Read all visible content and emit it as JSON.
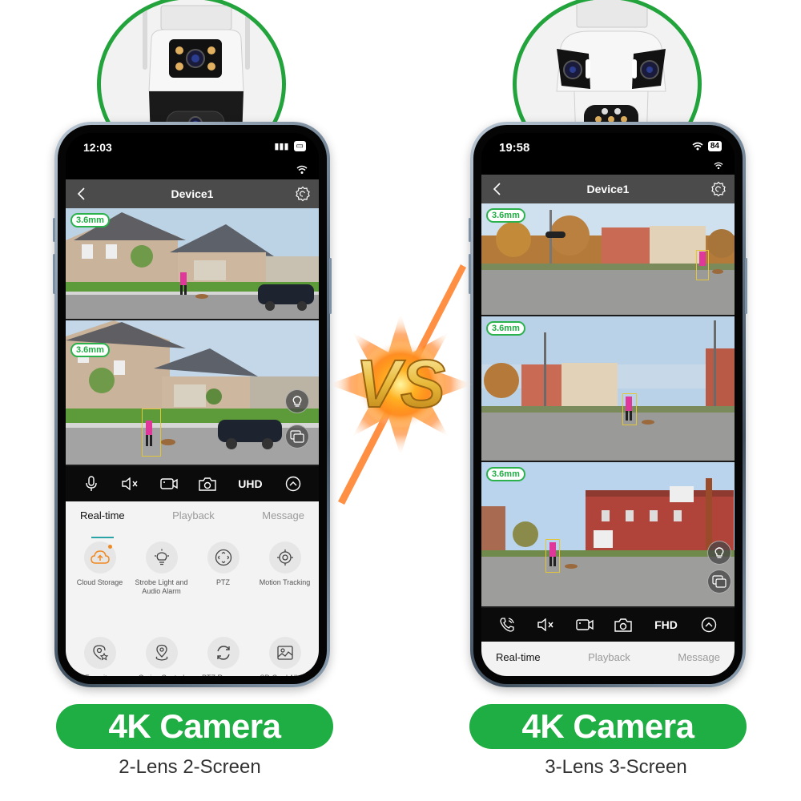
{
  "colors": {
    "accent_green": "#1fae43",
    "tab_indicator": "#2aa3a7",
    "cloud_orange": "#f08a24",
    "lens_tag_green": "#2bb24c"
  },
  "left_phone": {
    "status_time": "12:03",
    "battery": "",
    "header_title": "Device1",
    "panes": [
      {
        "lens_label": "3.6mm"
      },
      {
        "lens_label": "3.6mm"
      }
    ],
    "pane_buttons": [
      "light-icon",
      "multi-screen-icon"
    ],
    "controls": [
      {
        "icon": "microphone-icon"
      },
      {
        "icon": "mute-icon"
      },
      {
        "icon": "record-icon"
      },
      {
        "icon": "snapshot-icon"
      },
      {
        "label": "UHD"
      },
      {
        "icon": "chevron-up-icon"
      }
    ],
    "quality_label": "UHD",
    "tabs": [
      {
        "label": "Real-time",
        "active": true
      },
      {
        "label": "Playback",
        "active": false
      },
      {
        "label": "Message",
        "active": false
      }
    ],
    "features": [
      {
        "label": "Cloud Storage",
        "icon": "cloud-upload-icon"
      },
      {
        "label": "Strobe Light and Audio Alarm",
        "icon": "light-bulb-icon"
      },
      {
        "label": "PTZ",
        "icon": "ptz-icon"
      },
      {
        "label": "Motion Tracking",
        "icon": "target-icon"
      },
      {
        "label": "Favorites",
        "icon": "favorite-location-icon"
      },
      {
        "label": "Cruise Control",
        "icon": "location-pin-icon"
      },
      {
        "label": "PTZ Reverse",
        "icon": "rotate-icon"
      },
      {
        "label": "SD Card Album",
        "icon": "image-album-icon"
      }
    ],
    "banner": "4K Camera",
    "caption": "2-Lens 2-Screen"
  },
  "right_phone": {
    "status_time": "19:58",
    "battery": "84",
    "header_title": "Device1",
    "panes": [
      {
        "lens_label": "3.6mm"
      },
      {
        "lens_label": "3.6mm"
      },
      {
        "lens_label": "3.6mm"
      }
    ],
    "pane_buttons": [
      "light-icon",
      "multi-screen-icon"
    ],
    "controls": [
      {
        "icon": "phone-call-icon"
      },
      {
        "icon": "mute-icon"
      },
      {
        "icon": "record-icon"
      },
      {
        "icon": "snapshot-icon"
      },
      {
        "label": "FHD"
      },
      {
        "icon": "chevron-up-icon"
      }
    ],
    "quality_label": "FHD",
    "tabs": [
      {
        "label": "Real-time",
        "active": true
      },
      {
        "label": "Playback",
        "active": false
      },
      {
        "label": "Message",
        "active": false
      }
    ],
    "banner": "4K Camera",
    "caption": "3-Lens 3-Screen"
  },
  "vs_label": "VS"
}
